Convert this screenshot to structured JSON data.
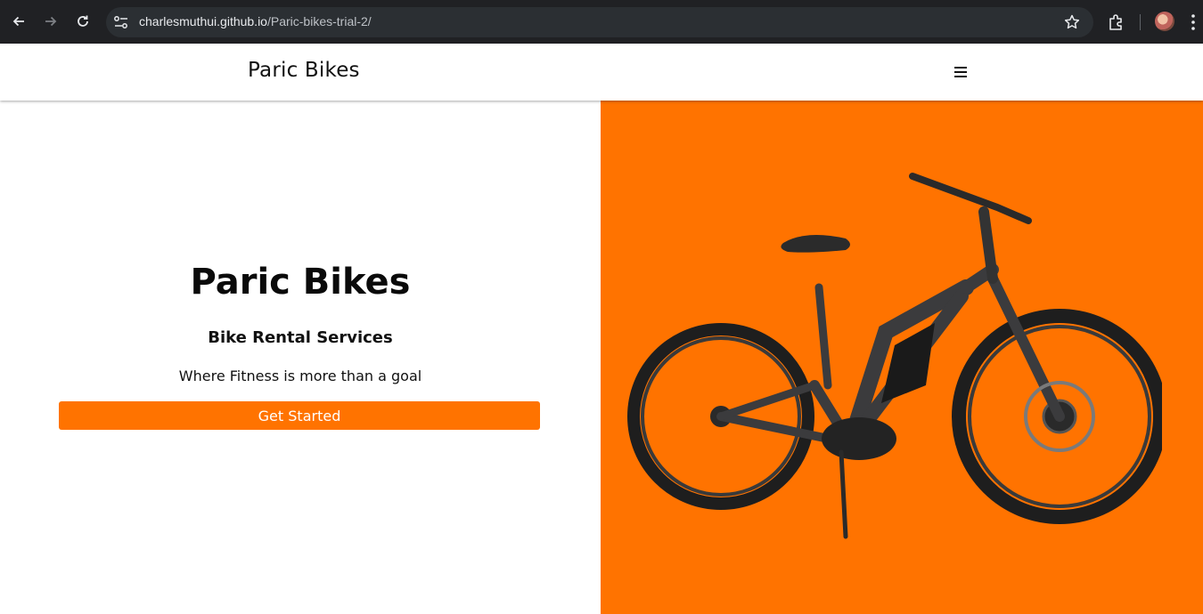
{
  "browser": {
    "url_host": "charlesmuthui.github.io",
    "url_path": "/Paric-bikes-trial-2/"
  },
  "header": {
    "brand": "Paric Bikes",
    "menu_icon": "hamburger-icon"
  },
  "hero": {
    "title": "Paric Bikes",
    "subtitle": "Bike Rental Services",
    "tagline": "Where Fitness is more than a goal",
    "cta_label": "Get Started"
  },
  "colors": {
    "accent": "#ff7300",
    "chrome": "#202124",
    "omnibox": "#2b2f33"
  }
}
